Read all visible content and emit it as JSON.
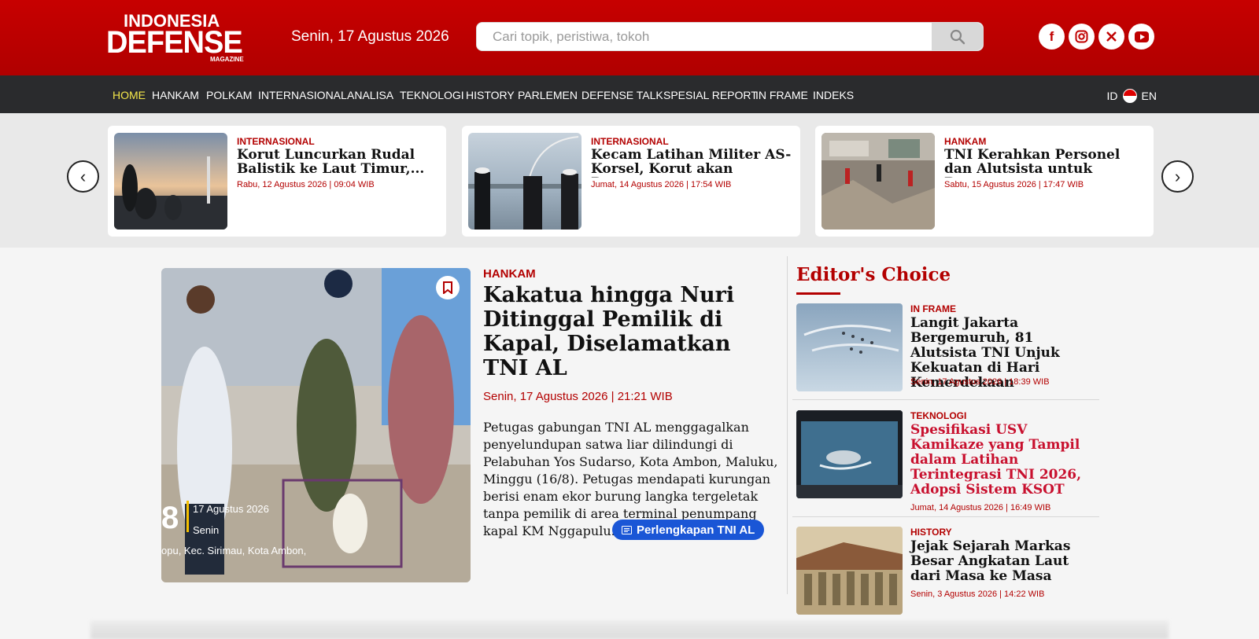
{
  "header": {
    "logo": {
      "line1": "INDONESIA",
      "line2": "DEFENSE",
      "line3": "MAGAZINE"
    },
    "date": "Senin, 17 Agustus 2026",
    "search_placeholder": "Cari topik, peristiwa, tokoh",
    "social": [
      "facebook-icon",
      "instagram-icon",
      "x-icon",
      "youtube-icon"
    ],
    "brand_color": "#c00000"
  },
  "nav": {
    "items": [
      "HOME",
      "HANKAM",
      "POLKAM",
      "INTERNASIONAL",
      "ANALISA",
      "TEKNOLOGI",
      "HISTORY",
      "PARLEMEN",
      "DEFENSE TALK",
      "SPESIAL REPORT",
      "IN FRAME",
      "INDEKS"
    ],
    "active": "HOME",
    "lang_id": "ID",
    "lang_en": "EN"
  },
  "carousel": [
    {
      "category": "INTERNASIONAL",
      "title": "Korut Luncurkan Rudal Balistik ke Laut Timur,...",
      "meta": "Rabu, 12 Agustus 2026 | 09:04 WIB"
    },
    {
      "category": "INTERNASIONAL",
      "title": "Kecam Latihan Militer AS-Korsel, Korut akan Respons...",
      "meta": "Jumat, 14 Agustus 2026 | 17:54 WIB"
    },
    {
      "category": "HANKAM",
      "title": "TNI Kerahkan Personel dan Alutsista untuk Bantu...",
      "meta": "Sabtu, 15 Agustus 2026 | 17:47 WIB"
    }
  ],
  "hero": {
    "category": "HANKAM",
    "title": "Kakatua hingga Nuri Ditinggal Pemilik di Kapal, Diselamatkan TNI AL",
    "date": "Senin, 17 Agustus 2026 | 21:21 WIB",
    "body": "Petugas gabungan TNI AL menggagalkan penyelundupan satwa liar dilindungi di Pelabuhan Yos Sudarso, Kota Ambon, Maluku, Minggu (16/8). Petugas mendapati kurungan berisi enam ekor burung langka tergeletak tanpa pemilik di area terminal penumpang kapal KM Nggapulu.",
    "tag": "Perlengkapan TNI AL",
    "image_overlay": {
      "number": "8",
      "date": "17 Agustus 2026",
      "day": "Senin",
      "location": "opu, Kec. Sirimau, Kota Ambon,"
    }
  },
  "editors_choice": {
    "heading": "Editor's Choice",
    "items": [
      {
        "category": "IN FRAME",
        "title": "Langit Jakarta Bergemuruh, 81 Alutsista TNI Unjuk Kekuatan di Hari Kemerdekaan",
        "meta": "Senin, 17 Agustus 2026 | 18:39 WIB"
      },
      {
        "category": "TEKNOLOGI",
        "title": "Spesifikasi USV Kamikaze yang Tampil dalam Latihan Terintegrasi TNI 2026, Adopsi Sistem KSOT",
        "meta": "Jumat, 14 Agustus 2026 | 16:49 WIB"
      },
      {
        "category": "HISTORY",
        "title": "Jejak Sejarah Markas Besar Angkatan Laut dari Masa ke Masa",
        "meta": "Senin, 3 Agustus 2026 | 14:22 WIB"
      }
    ]
  }
}
